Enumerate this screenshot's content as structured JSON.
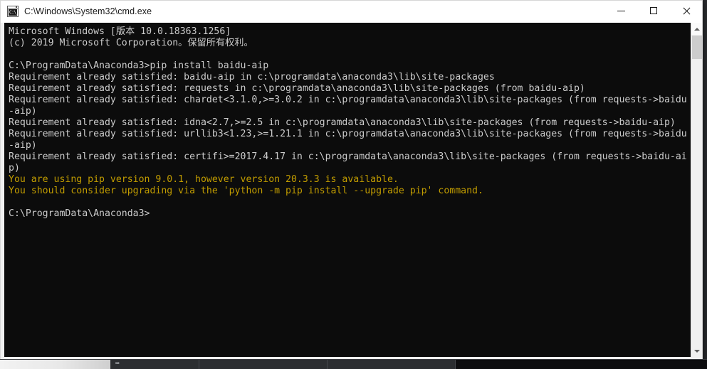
{
  "window": {
    "title": "C:\\Windows\\System32\\cmd.exe",
    "icon_name": "cmd-icon",
    "icon_text": "C:\\_",
    "controls": {
      "minimize_label": "Minimize",
      "maximize_label": "Maximize",
      "close_label": "Close"
    }
  },
  "console": {
    "background_color": "#0c0c0c",
    "foreground_color": "#cccccc",
    "warning_color": "#c19c00",
    "lines": [
      {
        "text": "Microsoft Windows [版本 10.0.18363.1256]",
        "color": "default"
      },
      {
        "text": "(c) 2019 Microsoft Corporation。保留所有权利。",
        "color": "default"
      },
      {
        "text": "",
        "color": "default"
      },
      {
        "text": "C:\\ProgramData\\Anaconda3>pip install baidu-aip",
        "color": "default"
      },
      {
        "text": "Requirement already satisfied: baidu-aip in c:\\programdata\\anaconda3\\lib\\site-packages",
        "color": "default"
      },
      {
        "text": "Requirement already satisfied: requests in c:\\programdata\\anaconda3\\lib\\site-packages (from baidu-aip)",
        "color": "default"
      },
      {
        "text": "Requirement already satisfied: chardet<3.1.0,>=3.0.2 in c:\\programdata\\anaconda3\\lib\\site-packages (from requests->baidu",
        "color": "default"
      },
      {
        "text": "-aip)",
        "color": "default"
      },
      {
        "text": "Requirement already satisfied: idna<2.7,>=2.5 in c:\\programdata\\anaconda3\\lib\\site-packages (from requests->baidu-aip)",
        "color": "default"
      },
      {
        "text": "Requirement already satisfied: urllib3<1.23,>=1.21.1 in c:\\programdata\\anaconda3\\lib\\site-packages (from requests->baidu",
        "color": "default"
      },
      {
        "text": "-aip)",
        "color": "default"
      },
      {
        "text": "Requirement already satisfied: certifi>=2017.4.17 in c:\\programdata\\anaconda3\\lib\\site-packages (from requests->baidu-ai",
        "color": "default"
      },
      {
        "text": "p)",
        "color": "default"
      },
      {
        "text": "You are using pip version 9.0.1, however version 20.3.3 is available.",
        "color": "warning"
      },
      {
        "text": "You should consider upgrading via the 'python -m pip install --upgrade pip' command.",
        "color": "warning"
      },
      {
        "text": "",
        "color": "default"
      },
      {
        "text": "C:\\ProgramData\\Anaconda3>",
        "color": "default"
      }
    ]
  },
  "scrollbar": {
    "up_arrow": "▲",
    "down_arrow": "▼"
  },
  "taskbar": {
    "icon": "⌨"
  }
}
